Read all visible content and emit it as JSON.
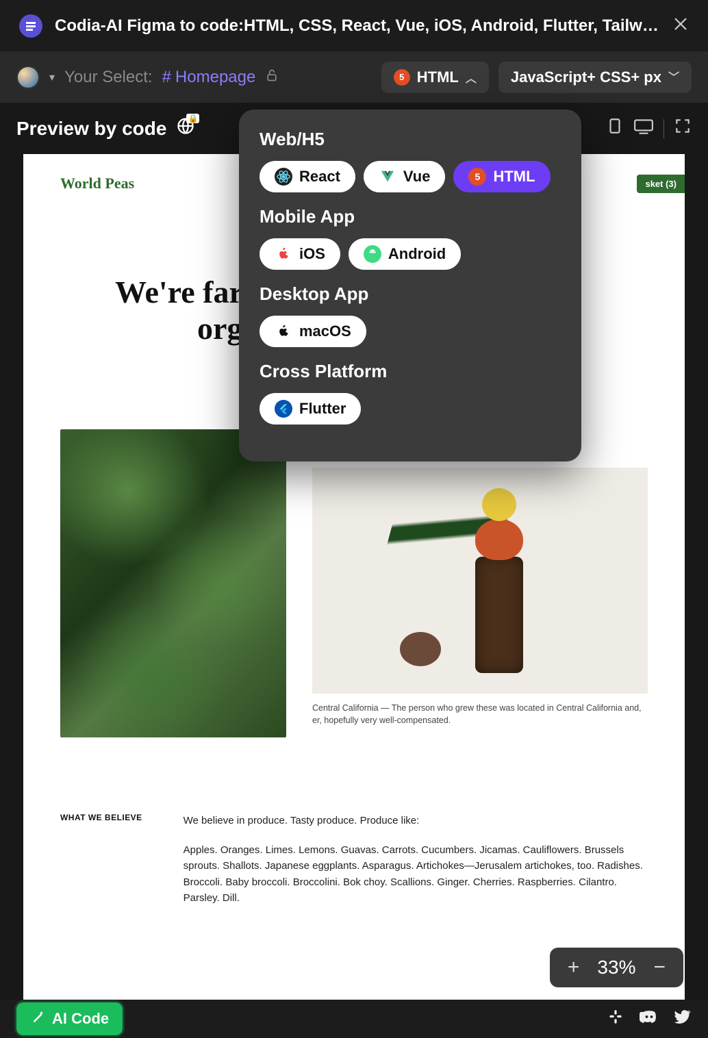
{
  "titlebar": {
    "title": "Codia-AI Figma to code:HTML, CSS, React, Vue, iOS, Android, Flutter, Tailwind, W..."
  },
  "toolbar": {
    "your_select_label": "Your Select:",
    "selection_name": "Homepage",
    "format_selected": "HTML",
    "lang_combo": "JavaScript+ CSS+ px"
  },
  "previewbar": {
    "label": "Preview by code"
  },
  "dropdown": {
    "sections": [
      {
        "title": "Web/H5",
        "chips": [
          {
            "label": "React",
            "active": false
          },
          {
            "label": "Vue",
            "active": false
          },
          {
            "label": "HTML",
            "active": true
          }
        ]
      },
      {
        "title": "Mobile App",
        "chips": [
          {
            "label": "iOS",
            "active": false
          },
          {
            "label": "Android",
            "active": false
          }
        ]
      },
      {
        "title": "Desktop App",
        "chips": [
          {
            "label": "macOS",
            "active": false
          }
        ]
      },
      {
        "title": "Cross Platform",
        "chips": [
          {
            "label": "Flutter",
            "active": false
          }
        ]
      }
    ]
  },
  "preview_page": {
    "brand": "World Peas",
    "basket": "sket (3)",
    "hero_line1": "We're farn",
    "hero_line2": "org",
    "caption": "Central California — The person who grew these was located in Central California and, er, hopefully very well-compensated.",
    "believe_label": "WHAT WE BELIEVE",
    "believe_p1": "We believe in produce. Tasty produce. Produce like:",
    "believe_p2": "Apples. Oranges. Limes. Lemons. Guavas. Carrots. Cucumbers. Jicamas. Cauliflowers. Brussels sprouts. Shallots. Japanese eggplants. Asparagus. Artichokes—Jerusalem artichokes, too. Radishes. Broccoli. Baby broccoli. Broccolini. Bok choy. Scallions. Ginger. Cherries. Raspberries. Cilantro. Parsley. Dill."
  },
  "zoom": {
    "value": "33%"
  },
  "footer": {
    "ai_code_label": "AI Code"
  }
}
